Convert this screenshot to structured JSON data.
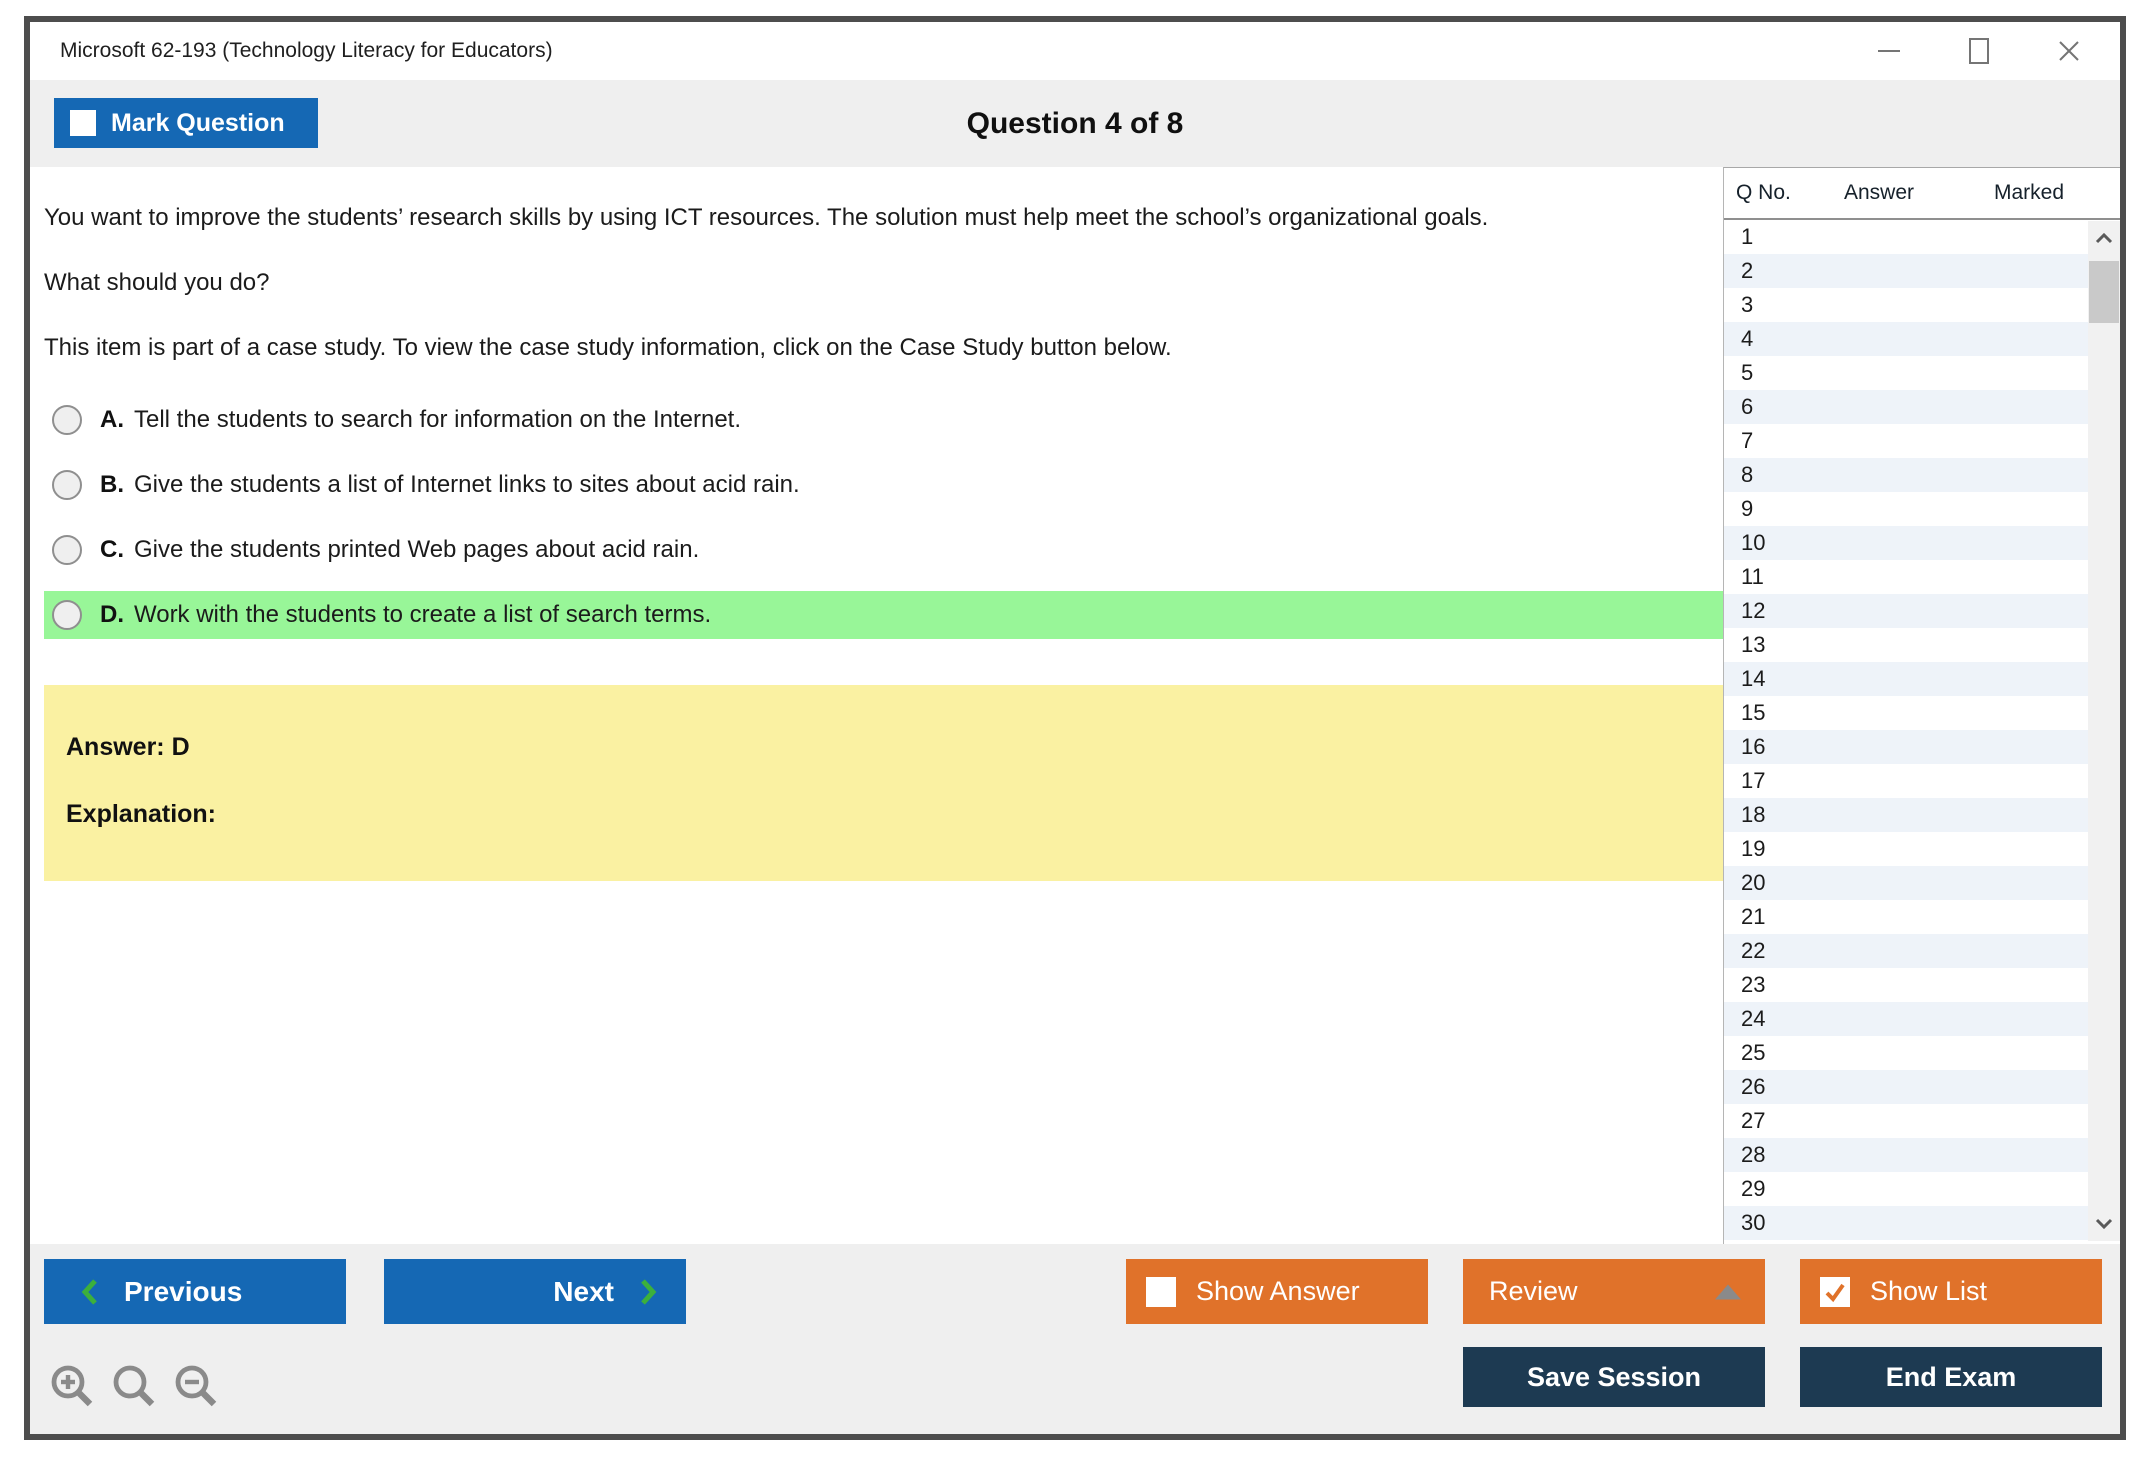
{
  "window": {
    "title": "Microsoft 62-193 (Technology Literacy for Educators)",
    "controls": [
      "minimize",
      "maximize",
      "close"
    ]
  },
  "header": {
    "mark_question": {
      "label": "Mark Question",
      "checkbox_state": "unchecked"
    },
    "question_counter": "Question 4 of 8"
  },
  "question": {
    "paragraphs": [
      "You want to improve the students’ research skills by using ICT resources. The solution must help meet the school’s organizational goals.",
      "What should you do?",
      "This item is part of a case study. To view the case study information, click on the Case Study button below."
    ],
    "options": [
      {
        "letter": "A.",
        "text": "Tell the students to search for information on the Internet.",
        "highlighted": false,
        "selected": false
      },
      {
        "letter": "B.",
        "text": "Give the students a list of Internet links to sites about acid rain.",
        "highlighted": false,
        "selected": false
      },
      {
        "letter": "C.",
        "text": "Give the students printed Web pages about acid rain.",
        "highlighted": false,
        "selected": false
      },
      {
        "letter": "D.",
        "text": "Work with the students to create a list of search terms.",
        "highlighted": true,
        "selected": false
      }
    ],
    "answer_box": {
      "answer_label": "Answer: D",
      "explanation_label": "Explanation:"
    }
  },
  "question_list": {
    "columns": [
      "Q No.",
      "Answer",
      "Marked"
    ],
    "rows": [
      {
        "q_no": "1",
        "answer": "",
        "marked": ""
      },
      {
        "q_no": "2",
        "answer": "",
        "marked": ""
      },
      {
        "q_no": "3",
        "answer": "",
        "marked": ""
      },
      {
        "q_no": "4",
        "answer": "",
        "marked": ""
      },
      {
        "q_no": "5",
        "answer": "",
        "marked": ""
      },
      {
        "q_no": "6",
        "answer": "",
        "marked": ""
      },
      {
        "q_no": "7",
        "answer": "",
        "marked": ""
      },
      {
        "q_no": "8",
        "answer": "",
        "marked": ""
      },
      {
        "q_no": "9",
        "answer": "",
        "marked": ""
      },
      {
        "q_no": "10",
        "answer": "",
        "marked": ""
      },
      {
        "q_no": "11",
        "answer": "",
        "marked": ""
      },
      {
        "q_no": "12",
        "answer": "",
        "marked": ""
      },
      {
        "q_no": "13",
        "answer": "",
        "marked": ""
      },
      {
        "q_no": "14",
        "answer": "",
        "marked": ""
      },
      {
        "q_no": "15",
        "answer": "",
        "marked": ""
      },
      {
        "q_no": "16",
        "answer": "",
        "marked": ""
      },
      {
        "q_no": "17",
        "answer": "",
        "marked": ""
      },
      {
        "q_no": "18",
        "answer": "",
        "marked": ""
      },
      {
        "q_no": "19",
        "answer": "",
        "marked": ""
      },
      {
        "q_no": "20",
        "answer": "",
        "marked": ""
      },
      {
        "q_no": "21",
        "answer": "",
        "marked": ""
      },
      {
        "q_no": "22",
        "answer": "",
        "marked": ""
      },
      {
        "q_no": "23",
        "answer": "",
        "marked": ""
      },
      {
        "q_no": "24",
        "answer": "",
        "marked": ""
      },
      {
        "q_no": "25",
        "answer": "",
        "marked": ""
      },
      {
        "q_no": "26",
        "answer": "",
        "marked": ""
      },
      {
        "q_no": "27",
        "answer": "",
        "marked": ""
      },
      {
        "q_no": "28",
        "answer": "",
        "marked": ""
      },
      {
        "q_no": "29",
        "answer": "",
        "marked": ""
      },
      {
        "q_no": "30",
        "answer": "",
        "marked": ""
      }
    ],
    "scrollbar": {
      "thumb_position": "near-top"
    }
  },
  "footer": {
    "previous": {
      "label": "Previous",
      "icon": "chevron-left"
    },
    "next": {
      "label": "Next",
      "icon": "chevron-right"
    },
    "show_answer": {
      "label": "Show Answer",
      "checkbox_state": "unchecked"
    },
    "review": {
      "label": "Review",
      "icon": "triangle-up"
    },
    "show_list": {
      "label": "Show List",
      "checkbox_state": "checked"
    },
    "save_session": {
      "label": "Save Session"
    },
    "end_exam": {
      "label": "End Exam"
    },
    "zoom_tools": [
      "zoom-in",
      "zoom-reset",
      "zoom-out"
    ]
  },
  "colors": {
    "primary_blue": "#1568b4",
    "accent_orange": "#e0722a",
    "dark_navy": "#1d3a52",
    "highlight_green": "#98f698",
    "answer_box_yellow": "#faf1a2",
    "row_alt_blue": "#eef3f9",
    "chevron_green": "#3cb03c",
    "band_gray": "#efefef"
  }
}
